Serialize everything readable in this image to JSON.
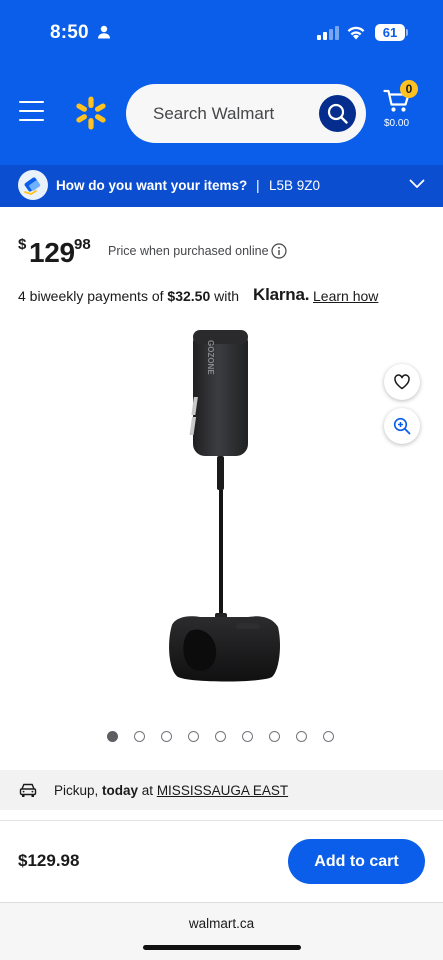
{
  "status_bar": {
    "time": "8:50",
    "battery": "61"
  },
  "header": {
    "search": {
      "placeholder": "Search Walmart"
    },
    "cart": {
      "count": "0",
      "amount": "$0.00"
    },
    "icons": {
      "menu": "hamburger-menu-icon",
      "logo": "walmart-spark-logo",
      "search": "search-icon",
      "cart": "cart-icon"
    }
  },
  "delivery": {
    "question": "How do you want your items?",
    "separator": "|",
    "postal_code": "L5B 9Z0"
  },
  "product": {
    "price": {
      "currency": "$",
      "whole": "129",
      "cents": "98"
    },
    "price_note": "Price when purchased online",
    "klarna": {
      "prefix": "4 biweekly payments of ",
      "amount": "$32.50",
      "suffix": " with",
      "brand": "Klarna.",
      "link": "Learn how"
    },
    "image_label": "GOZONE",
    "carousel": {
      "count": 9,
      "active_index": 0
    }
  },
  "pickup": {
    "label": "Pickup, ",
    "when": "today",
    "at": " at ",
    "store": "MISSISSAUGA EAST"
  },
  "footer": {
    "total": "$129.98",
    "add_to_cart": "Add to cart"
  },
  "browser": {
    "url": "walmart.ca"
  },
  "colors": {
    "brand_blue": "#0b5ee9",
    "dark_blue": "#042d8e",
    "spark_yellow": "#ffc220"
  }
}
